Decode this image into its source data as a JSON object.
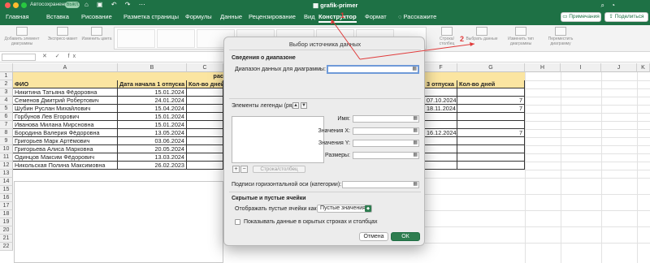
{
  "titlebar": {
    "autosave_label": "Автосохранение",
    "autosave_state": "ВЫКЛ.",
    "doc_title": "grafik-primer",
    "colors": {
      "accent": "#1e7145"
    }
  },
  "tabs": [
    {
      "label": "Главная"
    },
    {
      "label": "Вставка"
    },
    {
      "label": "Рисование"
    },
    {
      "label": "Разметка страницы"
    },
    {
      "label": "Формулы"
    },
    {
      "label": "Данные"
    },
    {
      "label": "Рецензирование"
    },
    {
      "label": "Вид"
    },
    {
      "label": "Конструктор",
      "active": true
    },
    {
      "label": "Формат"
    },
    {
      "label": "Расскажите"
    }
  ],
  "header_buttons": {
    "comments": "Примечания",
    "share": "Поделиться"
  },
  "ribbon": {
    "add_element": "Добавить элемент диаграммы",
    "quick_layout": "Экспресс-макет",
    "change_colors": "Изменить цвета",
    "switch_row_col": "Строка/столбец",
    "select_data": "Выбрать данные",
    "change_type": "Изменить тип диаграммы",
    "move_chart": "Переместить диаграмму"
  },
  "columns": [
    "A",
    "B",
    "C",
    "D",
    "E",
    "F",
    "G",
    "H",
    "I",
    "J",
    "K"
  ],
  "rows": [
    "1",
    "2",
    "3",
    "4",
    "5",
    "6",
    "7",
    "8",
    "9",
    "10",
    "11",
    "12",
    "13",
    "14",
    "15",
    "16",
    "17",
    "18",
    "19",
    "20",
    "21",
    "22"
  ],
  "sheet": {
    "row1_title": "рас",
    "header": {
      "fio": "ФИО",
      "start1": "Дата начала 1 отпуска",
      "days1": "Кол-во дней",
      "start3": "3 отпуска",
      "days3": "Кол-во дней"
    },
    "people": [
      {
        "name": "Никитина Татьяна Фёдоровна",
        "date": "15.01.2024",
        "f": "",
        "g": ""
      },
      {
        "name": "Семенов Дмитрий Робертович",
        "date": "24.01.2024",
        "f": "07.10.2024",
        "g": "7"
      },
      {
        "name": "Шубин Руслан Михайлович",
        "date": "15.04.2024",
        "f": "18.11.2024",
        "g": "7"
      },
      {
        "name": "Горбунов Лев Егорович",
        "date": "15.01.2024",
        "f": "",
        "g": ""
      },
      {
        "name": "Иванова Милана Мирсновна",
        "date": "15.01.2024",
        "f": "",
        "g": ""
      },
      {
        "name": "Бородина Валерия Фёдоровна",
        "date": "13.05.2024",
        "f": "16.12.2024",
        "g": "7"
      },
      {
        "name": "Григорьев Марк Артёмович",
        "date": "03.06.2024",
        "f": "",
        "g": ""
      },
      {
        "name": "Григорьева Алиса Марковна",
        "date": "20.05.2024",
        "f": "",
        "g": ""
      },
      {
        "name": "Одинцов Максим Фёдорович",
        "date": "13.03.2024",
        "f": "",
        "g": ""
      },
      {
        "name": "Никольская Полина Максимовна",
        "date": "26.02.2023",
        "f": "",
        "g": ""
      }
    ]
  },
  "dialog": {
    "title": "Выбор источника данных",
    "range_section": "Сведения о диапазоне",
    "range_label": "Диапазон данных для диаграммы:",
    "range_value": "",
    "legend_label": "Элементы легенды (ряд",
    "name_label": "Имя:",
    "x_label": "Значения X:",
    "y_label": "Значения Y:",
    "size_label": "Размеры:",
    "add_symbol": "+",
    "remove_symbol": "−",
    "row_col_button": "Строка/столбец",
    "axis_label": "Подписи горизонтальной оси (категории):",
    "hidden_section": "Скрытые и пустые ячейки",
    "show_empty_label": "Отображать пустые ячейки как:",
    "show_empty_value": "Пустые значения",
    "hidden_rows_label": "Показывать данные в скрытых строках и столбцах",
    "cancel": "Отмена",
    "ok": "ОК"
  },
  "annotations": {
    "marker_1": "1",
    "marker_2": "2",
    "color": "#e03a3a"
  }
}
